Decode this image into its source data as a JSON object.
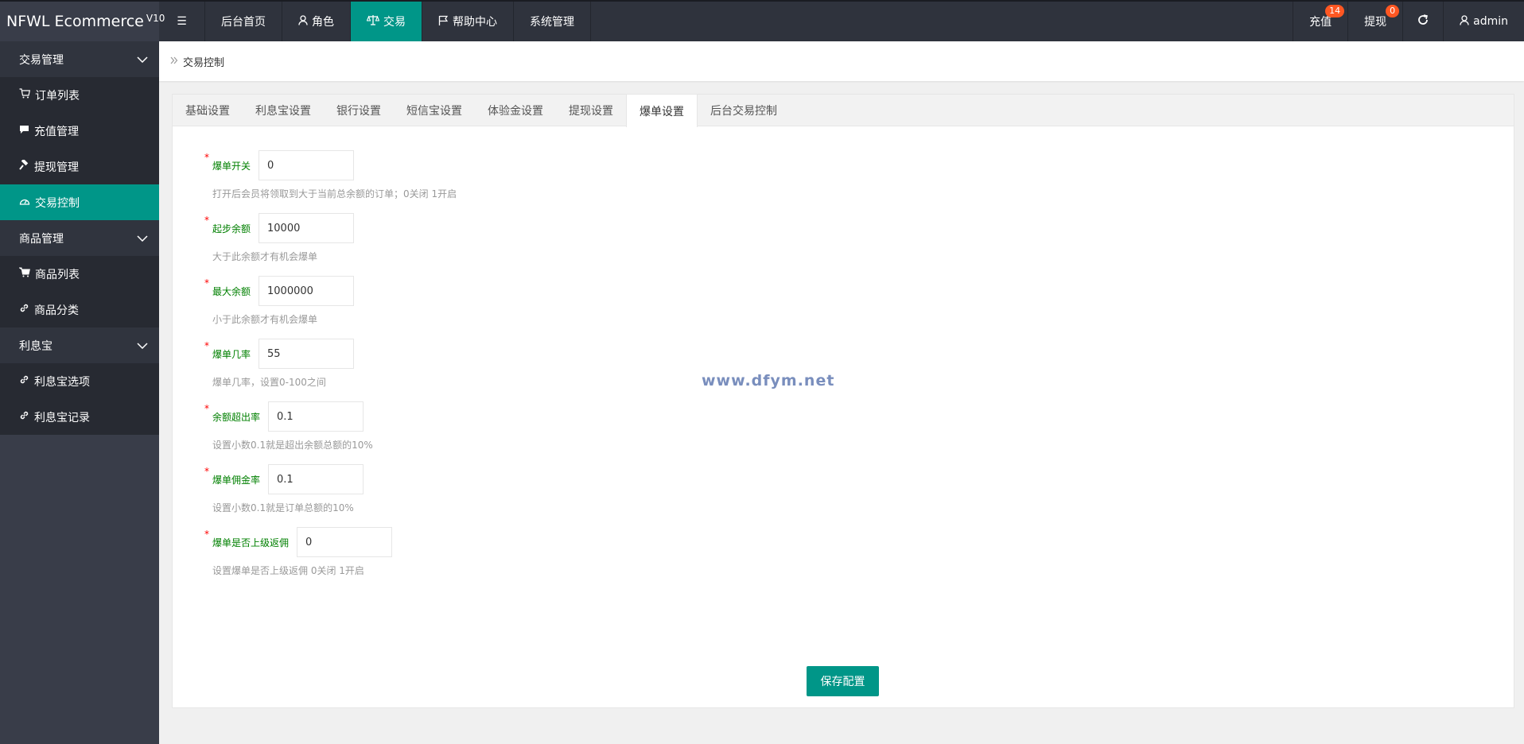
{
  "app": {
    "title": "NFWL Ecommerce",
    "version": "V10"
  },
  "topnav": {
    "items": [
      {
        "label": "后台首页",
        "icon": ""
      },
      {
        "label": "角色",
        "icon": "user-icon"
      },
      {
        "label": "交易",
        "icon": "scale-icon",
        "active": true
      },
      {
        "label": "帮助中心",
        "icon": "flag-icon"
      },
      {
        "label": "系统管理",
        "icon": ""
      }
    ]
  },
  "topright": {
    "recharge_label": "充值",
    "recharge_badge": "14",
    "withdraw_label": "提现",
    "withdraw_badge": "0",
    "user_label": "admin"
  },
  "sidebar": {
    "groups": [
      {
        "label": "交易管理",
        "items": [
          {
            "label": "订单列表",
            "icon": "cart-icon"
          },
          {
            "label": "充值管理",
            "icon": "comment-icon"
          },
          {
            "label": "提现管理",
            "icon": "hammer-icon"
          },
          {
            "label": "交易控制",
            "icon": "gauge-icon",
            "active": true
          }
        ]
      },
      {
        "label": "商品管理",
        "items": [
          {
            "label": "商品列表",
            "icon": "shopping-cart-icon"
          },
          {
            "label": "商品分类",
            "icon": "link-icon"
          }
        ]
      },
      {
        "label": "利息宝",
        "items": [
          {
            "label": "利息宝选项",
            "icon": "link-icon"
          },
          {
            "label": "利息宝记录",
            "icon": "link-icon"
          }
        ]
      }
    ]
  },
  "breadcrumb": {
    "current": "交易控制"
  },
  "tabs": [
    {
      "label": "基础设置"
    },
    {
      "label": "利息宝设置"
    },
    {
      "label": "银行设置"
    },
    {
      "label": "短信宝设置"
    },
    {
      "label": "体验金设置"
    },
    {
      "label": "提现设置"
    },
    {
      "label": "爆单设置",
      "active": true
    },
    {
      "label": "后台交易控制"
    }
  ],
  "form": {
    "fields": [
      {
        "label": "爆单开关",
        "value": "0",
        "hint": "打开后会员将领取到大于当前总余额的订单；0关闭 1开启"
      },
      {
        "label": "起步余额",
        "value": "10000",
        "hint": "大于此余额才有机会爆单"
      },
      {
        "label": "最大余额",
        "value": "1000000",
        "hint": "小于此余额才有机会爆单"
      },
      {
        "label": "爆单几率",
        "value": "55",
        "hint": "爆单几率，设置0-100之间"
      },
      {
        "label": "余额超出率",
        "value": "0.1",
        "hint": "设置小数0.1就是超出余额总额的10%"
      },
      {
        "label": "爆单佣金率",
        "value": "0.1",
        "hint": "设置小数0.1就是订单总额的10%"
      },
      {
        "label": "爆单是否上级返佣",
        "value": "0",
        "hint": "设置爆单是否上级返佣 0关闭 1开启"
      }
    ],
    "required_mark": "*",
    "save_label": "保存配置"
  },
  "watermark": "www.dfym.net",
  "colors": {
    "accent": "#009688",
    "header_bg": "#2f333d",
    "sidebar_bg": "#393d49",
    "badge": "#ff5722",
    "label_green": "#008000",
    "required_red": "#ff0000"
  }
}
